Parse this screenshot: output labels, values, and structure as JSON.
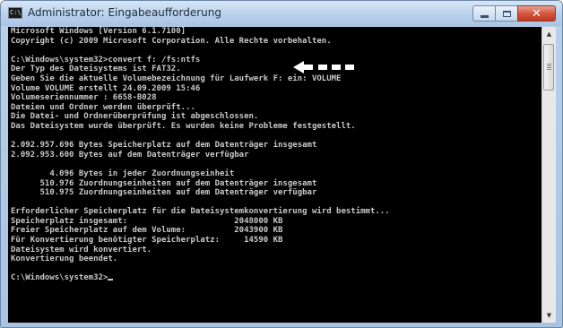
{
  "window": {
    "title": "Administrator: Eingabeaufforderung",
    "icon_text": "C:\\",
    "controls": {
      "minimize": "minimize-icon",
      "maximize": "maximize-icon",
      "close": "✕"
    }
  },
  "console": {
    "lines": [
      "Microsoft Windows [Version 6.1.7100]",
      "Copyright (c) 2009 Microsoft Corporation. Alle Rechte vorbehalten.",
      "",
      "C:\\Windows\\system32>convert f: /fs:ntfs",
      "Der Typ des Dateisystems ist FAT32.",
      "Geben Sie die aktuelle Volumebezeichnung für Laufwerk F: ein: VOLUME",
      "Volume VOLUME erstellt 24.09.2009 15:46",
      "Volumeseriennummer : 6658-B028",
      "Dateien und Ordner werden überprüft...",
      "Die Datei- und Ordnerüberprüfung ist abgeschlossen.",
      "Das Dateisystem wurde überprüft. Es wurden keine Probleme festgestellt.",
      "",
      "2.092.957.696 Bytes Speicherplatz auf dem Datenträger insgesamt",
      "2.092.953.600 Bytes auf dem Datenträger verfügbar",
      "",
      "        4.096 Bytes in jeder Zuordnungseinheit",
      "      510.976 Zuordnungseinheiten auf dem Datenträger insgesamt",
      "      510.975 Zuordnungseinheiten auf dem Datenträger verfügbar",
      "",
      "Erforderlicher Speicherplatz für die Dateisystemkonvertierung wird bestimmt...",
      "Speicherplatz insgesamt:                      2048000 KB",
      "Freier Speicherplatz auf dem Volume:          2043900 KB",
      "Für Konvertierung benötigter Speicherplatz:     14590 KB",
      "Dateisystem wird konvertiert.",
      "Konvertierung beendet.",
      "",
      "C:\\Windows\\system32>"
    ]
  },
  "annotation": {
    "arrow": "left-arrow-icon",
    "color": "#ffffff"
  },
  "scrollbar": {
    "up": "▲",
    "down": "▼"
  }
}
